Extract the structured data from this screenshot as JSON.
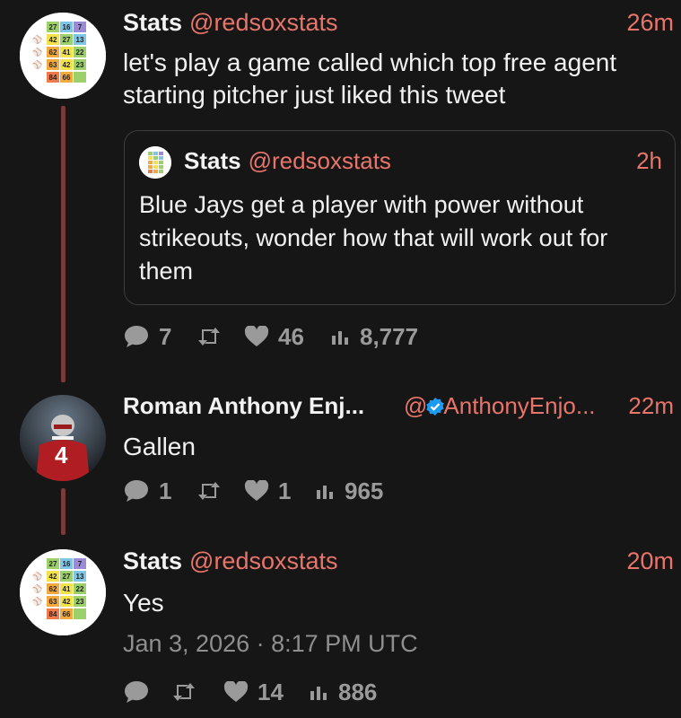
{
  "tweets": [
    {
      "name": "Stats",
      "handle": "@redsoxstats",
      "time": "26m",
      "text_line1": "let's play a game called which top free agent",
      "text_line2": "starting pitcher just liked this tweet",
      "quote": {
        "name": "Stats",
        "handle": "@redsoxstats",
        "time": "2h",
        "line1": "Blue Jays get a player with power without",
        "line2": "strikeouts, wonder how that will work out for",
        "line3": "them"
      },
      "replies": "7",
      "likes": "46",
      "views": "8,777"
    },
    {
      "name": "Roman Anthony Enj...",
      "handle_prefix": "@",
      "handle_rest": "AnthonyEnjo...",
      "time": "22m",
      "text": "Gallen",
      "replies": "1",
      "likes": "1",
      "views": "965",
      "avatar_jersey_number": "4"
    },
    {
      "name": "Stats",
      "handle": "@redsoxstats",
      "time": "20m",
      "text": "Yes",
      "date": "Jan 3, 2026 · 8:17 PM UTC",
      "likes": "14",
      "views": "886"
    }
  ],
  "avatar_grid": [
    [
      "",
      "27",
      "16",
      "7"
    ],
    [
      "",
      "42",
      "27",
      "13"
    ],
    [
      "",
      "62",
      "41",
      "22"
    ],
    [
      "",
      "63",
      "42",
      "23"
    ],
    [
      "",
      "84",
      "66",
      ""
    ]
  ],
  "colors": {
    "accent": "#e8756a",
    "thread": "#7a3a3a",
    "muted": "#9a9a9a",
    "background": "#161616"
  },
  "icons": {
    "reply": "reply-icon",
    "retweet": "retweet-icon",
    "like": "heart-icon",
    "views": "views-icon",
    "verified": "verified-badge-icon"
  }
}
